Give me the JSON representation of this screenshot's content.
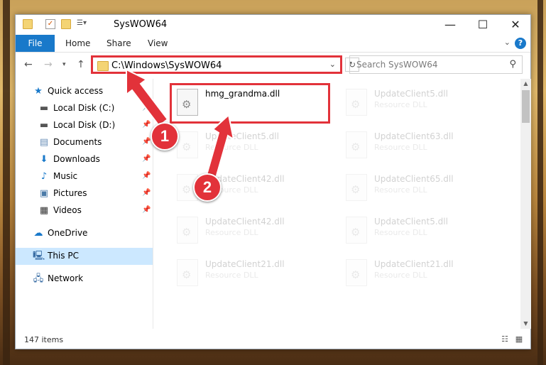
{
  "window": {
    "title": "SysWOW64",
    "controls": {
      "minimize": "—",
      "maximize": "☐",
      "close": "✕"
    }
  },
  "ribbon": {
    "tabs": [
      "File",
      "Home",
      "Share",
      "View"
    ],
    "help": "?"
  },
  "navigation": {
    "address": "C:\\Windows\\SysWOW64",
    "search_placeholder": "Search SysWOW64"
  },
  "sidebar": {
    "items": [
      {
        "label": "Quick access",
        "icon": "star-icon"
      },
      {
        "label": "Local Disk (C:)",
        "icon": "drive-icon",
        "pinned": true
      },
      {
        "label": "Local Disk (D:)",
        "icon": "drive-icon",
        "pinned": true
      },
      {
        "label": "Documents",
        "icon": "documents-icon",
        "pinned": true
      },
      {
        "label": "Downloads",
        "icon": "download-icon",
        "pinned": true
      },
      {
        "label": "Music",
        "icon": "music-icon",
        "pinned": true
      },
      {
        "label": "Pictures",
        "icon": "pictures-icon",
        "pinned": true
      },
      {
        "label": "Videos",
        "icon": "videos-icon",
        "pinned": true
      },
      {
        "label": "OneDrive",
        "icon": "cloud-icon"
      },
      {
        "label": "This PC",
        "icon": "computer-icon",
        "selected": true
      },
      {
        "label": "Network",
        "icon": "network-icon"
      }
    ]
  },
  "files": [
    {
      "name": "hmg_grandma.dll",
      "type": ""
    },
    {
      "name": "UpdateClient5.dll",
      "type": "Resource DLL"
    },
    {
      "name": "UpdateClient5.dll",
      "type": "Resource DLL"
    },
    {
      "name": "UpdateClient63.dll",
      "type": "Resource DLL"
    },
    {
      "name": "UpdateClient42.dll",
      "type": "Resource DLL"
    },
    {
      "name": "UpdateClient65.dll",
      "type": "Resource DLL"
    },
    {
      "name": "UpdateClient42.dll",
      "type": "Resource DLL"
    },
    {
      "name": "UpdateClient5.dll",
      "type": "Resource DLL"
    },
    {
      "name": "UpdateClient21.dll",
      "type": "Resource DLL"
    },
    {
      "name": "UpdateClient21.dll",
      "type": "Resource DLL"
    }
  ],
  "status": {
    "item_count": "147 items"
  },
  "callouts": [
    "1",
    "2"
  ],
  "colors": {
    "accent": "#1979ca",
    "highlight": "#e2323a",
    "selected": "#cce8ff"
  }
}
